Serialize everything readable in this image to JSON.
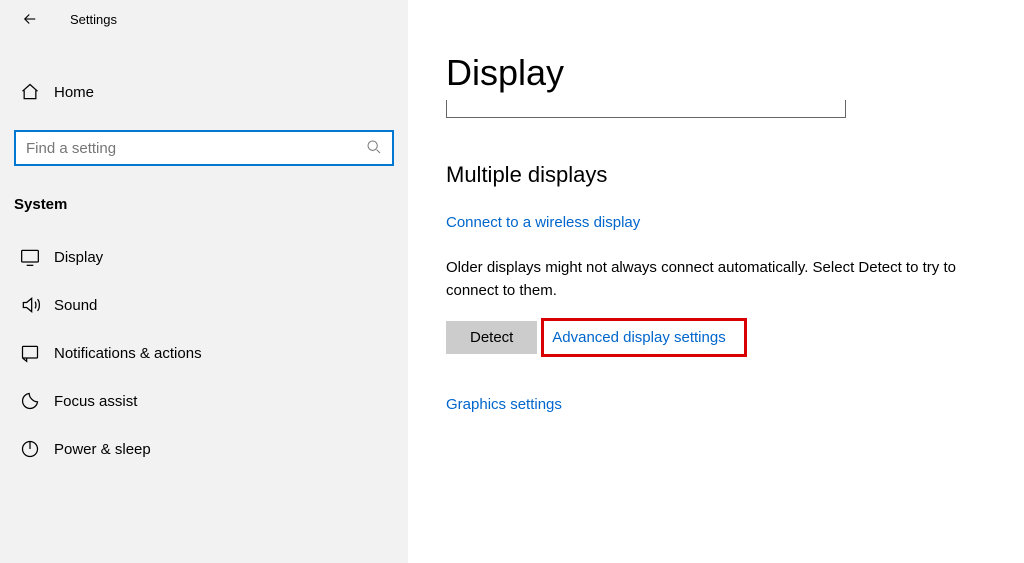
{
  "header": {
    "title": "Settings"
  },
  "home": {
    "label": "Home"
  },
  "search": {
    "placeholder": "Find a setting"
  },
  "section": {
    "title": "System"
  },
  "nav": {
    "display": "Display",
    "sound": "Sound",
    "notifications": "Notifications & actions",
    "focus": "Focus assist",
    "power": "Power & sleep"
  },
  "main": {
    "title": "Display",
    "multiple_heading": "Multiple displays",
    "connect_link": "Connect to a wireless display",
    "detect_desc": "Older displays might not always connect automatically. Select Detect to try to connect to them.",
    "detect_btn": "Detect",
    "advanced_link": "Advanced display settings",
    "graphics_link": "Graphics settings"
  }
}
